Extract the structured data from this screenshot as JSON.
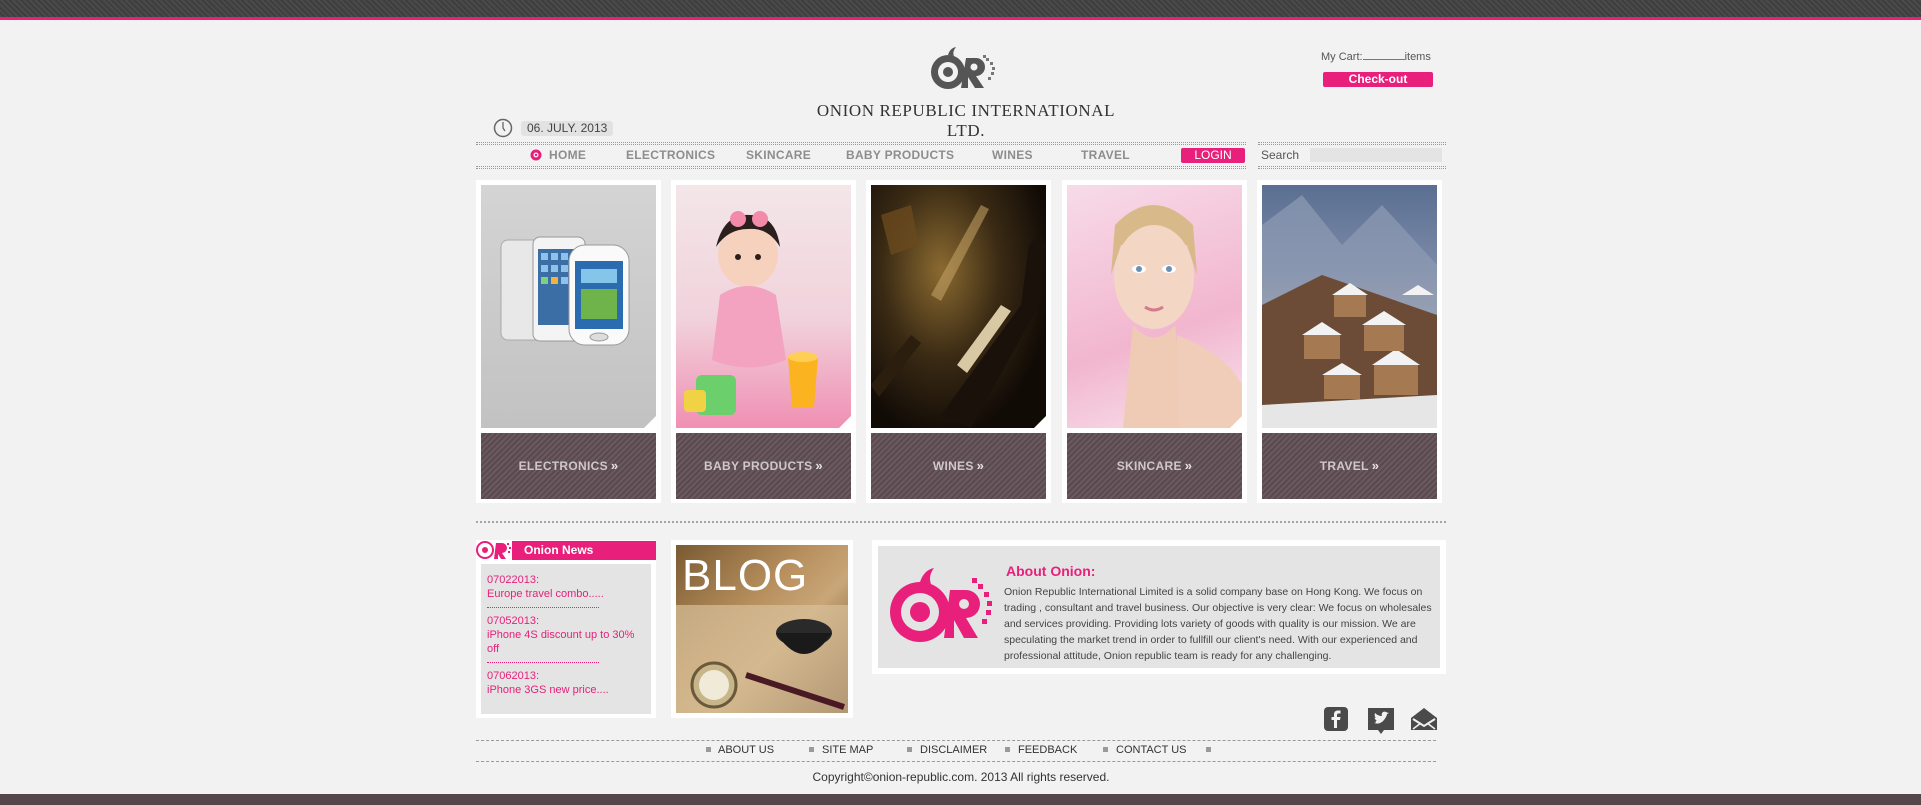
{
  "header": {
    "company_name": "ONION REPUBLIC INTERNATIONAL LTD.",
    "cart_prefix": "My Cart:",
    "cart_suffix": "items",
    "checkout_label": "Check-out",
    "date": "06. JULY. 2013"
  },
  "nav": {
    "items": [
      "HOME",
      "ELECTRONICS",
      "SKINCARE",
      "BABY PRODUCTS",
      "WINES",
      "TRAVEL"
    ],
    "login_label": "LOGIN",
    "search_label": "Search"
  },
  "categories": [
    {
      "label": "ELECTRONICS"
    },
    {
      "label": "BABY PRODUCTS"
    },
    {
      "label": "WINES"
    },
    {
      "label": "SKINCARE"
    },
    {
      "label": "TRAVEL"
    }
  ],
  "news": {
    "title": "Onion News",
    "items": [
      {
        "date": "07022013:",
        "text": "Europe travel combo....."
      },
      {
        "date": "07052013:",
        "text": "iPhone 4S discount up to 30% off"
      },
      {
        "date": "07062013:",
        "text": "iPhone 3GS new price...."
      }
    ]
  },
  "blog": {
    "title": "BLOG"
  },
  "about": {
    "title": "About Onion:",
    "text": "Onion Republic International Limited is a solid company base on Hong Kong. We focus on trading , consultant and travel business. Our objective is very clear: We focus on wholesales and services providing. Providing lots variety of goods with quality is our mission. We are speculating the market trend in order to fullfill our client's need. With our experienced and professional attitude, Onion republic team is ready for any challenging."
  },
  "social": [
    "facebook-icon",
    "twitter-icon",
    "email-icon"
  ],
  "footer": {
    "links": [
      "ABOUT US",
      "SITE MAP",
      "DISCLAIMER",
      "FEEDBACK",
      "CONTACT US"
    ],
    "copyright": "Copyright©onion-republic.com. 2013 All rights reserved."
  },
  "colors": {
    "accent": "#e8207b",
    "tile": "#5f5055",
    "topbar": "#444444"
  }
}
